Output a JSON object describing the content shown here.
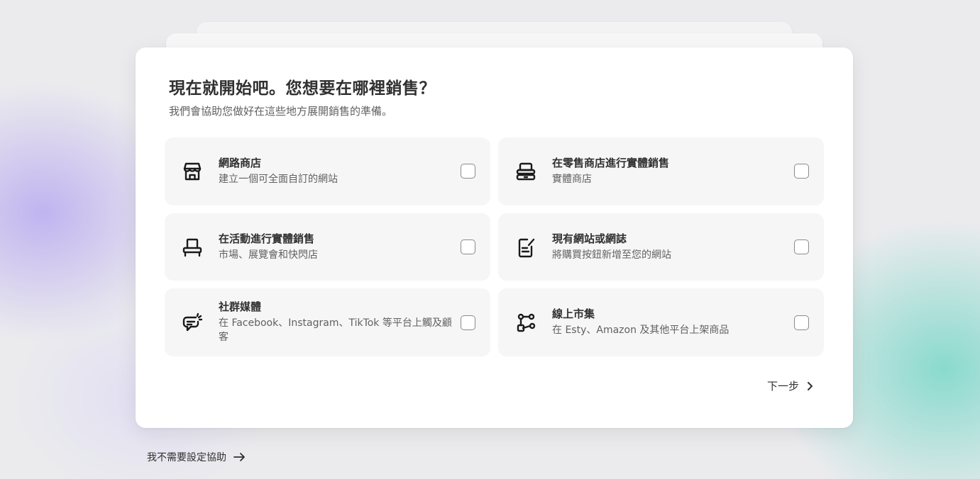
{
  "header": {
    "title": "現在就開始吧。您想要在哪裡銷售？",
    "subtitle": "我們會協助您做好在這些地方展開銷售的準備。"
  },
  "options": [
    {
      "title": "網路商店",
      "description": "建立一個可全面自訂的網站",
      "icon": "store-icon",
      "checked": false
    },
    {
      "title": "在零售商店進行實體銷售",
      "description": "實體商店",
      "icon": "pos-terminal-icon",
      "checked": false
    },
    {
      "title": "在活動進行實體銷售",
      "description": "市場、展覽會和快閃店",
      "icon": "market-stall-icon",
      "checked": false
    },
    {
      "title": "現有網站或網誌",
      "description": "將購買按鈕新增至您的網站",
      "icon": "edit-document-icon",
      "checked": false
    },
    {
      "title": "社群媒體",
      "description": "在 Facebook、Instagram、TikTok 等平台上觸及顧客",
      "icon": "social-chat-icon",
      "checked": false
    },
    {
      "title": "線上市集",
      "description": "在 Esty、Amazon 及其他平台上架商品",
      "icon": "marketplace-nodes-icon",
      "checked": false
    }
  ],
  "footer": {
    "next_label": "下一步",
    "skip_label": "我不需要設定協助"
  }
}
